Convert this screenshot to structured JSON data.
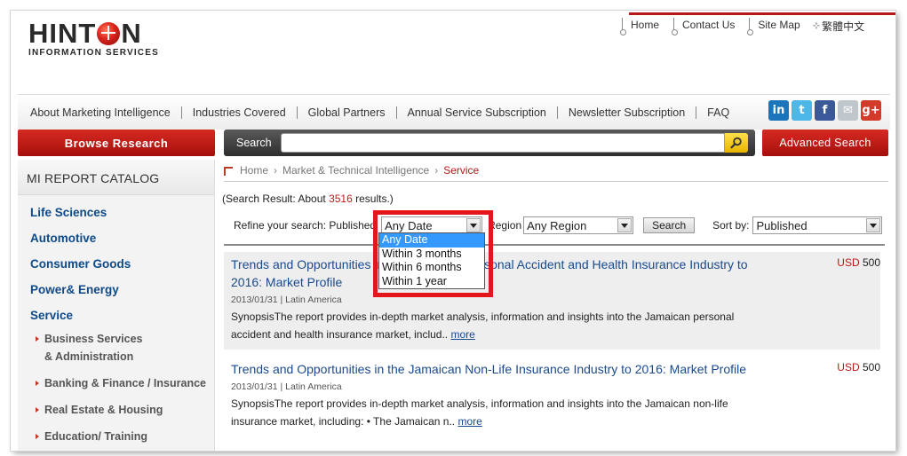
{
  "logo": {
    "word_left": "HINT",
    "word_right": "N",
    "subtitle": "INFORMATION SERVICES"
  },
  "top_links": [
    "Home",
    "Contact Us",
    "Site Map"
  ],
  "language": "繁體中文",
  "nav": [
    "About Marketing Intelligence",
    "Industries Covered",
    "Global Partners",
    "Annual Service Subscription",
    "Newsletter Subscription",
    "FAQ"
  ],
  "social": [
    {
      "icon": "linkedin-icon",
      "glyph": "in",
      "color": "#1b75bb"
    },
    {
      "icon": "twitter-icon",
      "glyph": "t",
      "color": "#4db8e8"
    },
    {
      "icon": "facebook-icon",
      "glyph": "f",
      "color": "#3b5998"
    },
    {
      "icon": "email-icon",
      "glyph": "✉",
      "color": "#bfc6cc"
    },
    {
      "icon": "google-plus-icon",
      "glyph": "g+",
      "color": "#d23a2a"
    }
  ],
  "browse_label": "Browse Research",
  "search": {
    "label": "Search",
    "value": ""
  },
  "advanced_label": "Advanced Search",
  "sidebar": {
    "title": "MI REPORT CATALOG",
    "categories": [
      "Life Sciences",
      "Automotive",
      "Consumer Goods",
      "Power& Energy",
      "Service"
    ],
    "subcategories": [
      "Business Services & Administration",
      "Banking & Finance / Insurance",
      "Real Estate & Housing",
      "Education/ Training"
    ]
  },
  "breadcrumb": {
    "home": "Home",
    "section": "Market & Technical Intelligence",
    "current": "Service"
  },
  "summary": {
    "prefix": "(Search Result: About ",
    "count": "3516",
    "suffix": " results.)"
  },
  "refine": {
    "label": "Refine your search: Published",
    "date_value": "Any Date",
    "region_label": "Region",
    "region_value": "Any Region",
    "search_label": "Search",
    "sort_label": "Sort by:",
    "sort_value": "Published"
  },
  "date_options": [
    "Any Date",
    "Within 3 months",
    "Within 6 months",
    "Within 1 year"
  ],
  "results": [
    {
      "title": "Trends and Opportunities in the Jamaican Personal Accident and Health Insurance Industry to 2016: Market Profile",
      "currency": "USD",
      "price": "500",
      "meta": "2013/01/31 | Latin America",
      "text": "SynopsisThe report provides in-depth market analysis, information and insights into the Jamaican personal accident and health insurance market, includ.. ",
      "more": "more"
    },
    {
      "title": "Trends and Opportunities in the Jamaican Non-Life Insurance Industry to 2016: Market Profile",
      "currency": "USD",
      "price": "500",
      "meta": "2013/01/31 | Latin America",
      "text": "SynopsisThe report provides in-depth market analysis, information and insights into the Jamaican non-life insurance market, including: •   The Jamaican n.. ",
      "more": "more"
    }
  ]
}
